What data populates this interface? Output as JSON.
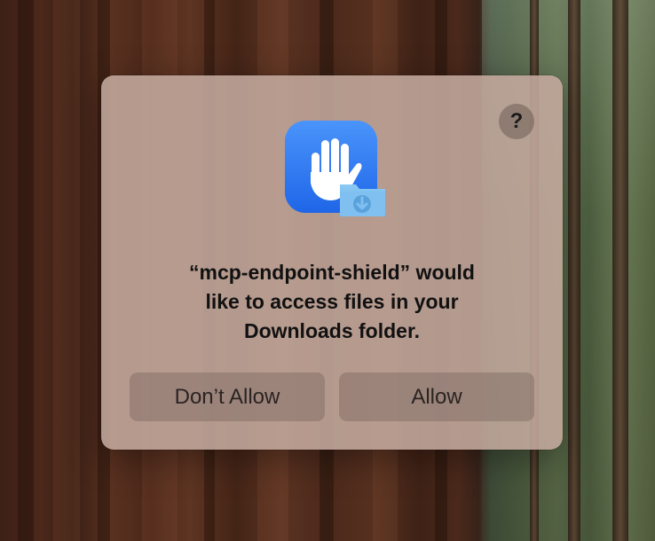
{
  "dialog": {
    "message_line1": "“mcp-endpoint-shield” would",
    "message_line2": "like to access files in your",
    "message_line3": "Downloads folder.",
    "help_label": "?",
    "icon": "privacy-hand-folder-icon",
    "buttons": {
      "dont_allow": "Don’t Allow",
      "allow": "Allow"
    }
  },
  "colors": {
    "icon_blue": "#2f7bf5",
    "folder_blue": "#74b8ec"
  }
}
